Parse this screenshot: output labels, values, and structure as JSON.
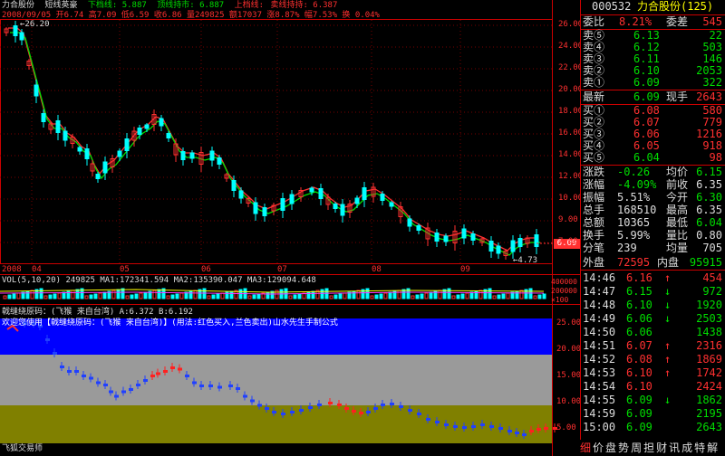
{
  "header": {
    "stock_short": "力合股份",
    "indicator_name": "短线英豪",
    "legend_items": [
      {
        "text": "下档线: 5.887",
        "color": "#00dd00"
      },
      {
        "text": "顶线持市: 6.887",
        "color": "#00dd00"
      },
      {
        "text": "上档线: ",
        "color": "#ff3030"
      },
      {
        "text": "卖线持持: 6.387",
        "color": "#ff3030"
      }
    ],
    "date_row": "2008/09/05 开6.74 高7.09 低6.59 收6.86 量249825 额17037 涨8.87% 幅7.53% 换 0.04%",
    "peak_label": "26.20",
    "low_label": "4.73",
    "last_price_tag": "6.09"
  },
  "price_axis": [
    "26.00",
    "24.00",
    "22.00",
    "20.00",
    "18.00",
    "16.00",
    "14.00",
    "12.00",
    "10.00",
    "9.00",
    "7.00"
  ],
  "time_axis": [
    "2008",
    "04",
    "05",
    "06",
    "07",
    "08",
    "09"
  ],
  "vol_header": "VOL(5,10,20)  249825  MA1:172341.594  MA2:135390.047  MA3:129094.648",
  "vol_axis": [
    "400000",
    "200000",
    "×100"
  ],
  "panel2": {
    "title": "戟缝绕原码：(飞猴  来自台湾)  A:6.372 B:6.192",
    "welcome": "欢迎您使用【戟缝绕原码：(飞猴  来自台湾)】(用法:红色买入,兰色卖出)山水先生手制公式",
    "axis": [
      "25.00",
      "20.00",
      "15.00",
      "10.00",
      "5.00"
    ],
    "footer": "飞狐交易师"
  },
  "right": {
    "code": "000532",
    "name": "力合股份(125)",
    "weibi_label": "委比",
    "weibi_value": "8.21%",
    "weicha_label": "委差",
    "weicha_value": "545",
    "asks": [
      {
        "label": "卖⑤",
        "price": "6.13",
        "vol": "22"
      },
      {
        "label": "卖④",
        "price": "6.12",
        "vol": "503"
      },
      {
        "label": "卖③",
        "price": "6.11",
        "vol": "146"
      },
      {
        "label": "卖②",
        "price": "6.10",
        "vol": "2053"
      },
      {
        "label": "卖①",
        "price": "6.09",
        "vol": "322"
      }
    ],
    "latest_label": "最新",
    "latest_value": "6.09",
    "xianshou_label": "现手",
    "xianshou_value": "2643",
    "bids": [
      {
        "label": "买①",
        "price": "6.08",
        "vol": "580"
      },
      {
        "label": "买②",
        "price": "6.07",
        "vol": "779"
      },
      {
        "label": "买③",
        "price": "6.06",
        "vol": "1216"
      },
      {
        "label": "买④",
        "price": "6.05",
        "vol": "918"
      },
      {
        "label": "买⑤",
        "price": "6.04",
        "vol": "98"
      }
    ],
    "stats": [
      {
        "l1": "涨跌",
        "v1": "-0.26",
        "c1": "#00dd00",
        "l2": "均价",
        "v2": "6.15",
        "c2": "#00dd00"
      },
      {
        "l1": "涨幅",
        "v1": "-4.09%",
        "c1": "#00dd00",
        "l2": "前收",
        "v2": "6.35",
        "c2": "#dddddd"
      },
      {
        "l1": "振幅",
        "v1": "5.51%",
        "c1": "#dddddd",
        "l2": "今开",
        "v2": "6.30",
        "c2": "#00dd00"
      },
      {
        "l1": "总手",
        "v1": "168510",
        "c1": "#dddddd",
        "l2": "最高",
        "v2": "6.35",
        "c2": "#dddddd"
      },
      {
        "l1": "总额",
        "v1": "10365",
        "c1": "#dddddd",
        "l2": "最低",
        "v2": "6.04",
        "c2": "#00dd00"
      },
      {
        "l1": "换手",
        "v1": "5.99%",
        "c1": "#dddddd",
        "l2": "量比",
        "v2": "0.80",
        "c2": "#dddddd"
      },
      {
        "l1": "分笔",
        "v1": "239",
        "c1": "#dddddd",
        "l2": "均量",
        "v2": "705",
        "c2": "#dddddd"
      }
    ],
    "waipan_label": "外盘",
    "waipan_value": "72595",
    "neipan_label": "内盘",
    "neipan_value": "95915",
    "ticks": [
      {
        "time": "14:46",
        "price": "6.16",
        "vol": "454",
        "dir": "up",
        "pc": "#ff3030"
      },
      {
        "time": "14:47",
        "price": "6.15",
        "vol": "972",
        "dir": "down",
        "pc": "#00dd00"
      },
      {
        "time": "14:48",
        "price": "6.10",
        "vol": "1920",
        "dir": "down",
        "pc": "#00dd00"
      },
      {
        "time": "14:49",
        "price": "6.06",
        "vol": "2503",
        "dir": "down",
        "pc": "#00dd00"
      },
      {
        "time": "14:50",
        "price": "6.06",
        "vol": "1438",
        "dir": "",
        "pc": "#00dd00"
      },
      {
        "time": "14:51",
        "price": "6.07",
        "vol": "2316",
        "dir": "up",
        "pc": "#ff3030"
      },
      {
        "time": "14:52",
        "price": "6.08",
        "vol": "1869",
        "dir": "up",
        "pc": "#ff3030"
      },
      {
        "time": "14:53",
        "price": "6.10",
        "vol": "1742",
        "dir": "up",
        "pc": "#ff3030"
      },
      {
        "time": "14:54",
        "price": "6.10",
        "vol": "2424",
        "dir": "",
        "pc": "#ff3030"
      },
      {
        "time": "14:55",
        "price": "6.09",
        "vol": "1862",
        "dir": "down",
        "pc": "#00dd00"
      },
      {
        "time": "14:59",
        "price": "6.09",
        "vol": "2195",
        "dir": "",
        "pc": "#00dd00"
      },
      {
        "time": "15:00",
        "price": "6.09",
        "vol": "2643",
        "dir": "",
        "pc": "#00dd00"
      }
    ],
    "tabs": [
      "细",
      "价",
      "盘",
      "势",
      "周",
      "担",
      "财",
      "讯",
      "成",
      "特",
      "解"
    ]
  },
  "colors": {
    "up": "#ff3030",
    "down": "#00dd00",
    "ask_price": "#00dd00",
    "bid_price": "#ff3030",
    "vol_yellow": "#ffff00",
    "band_blue": "#0000ff",
    "band_gray": "#9a9a9a",
    "band_olive": "#808000"
  }
}
